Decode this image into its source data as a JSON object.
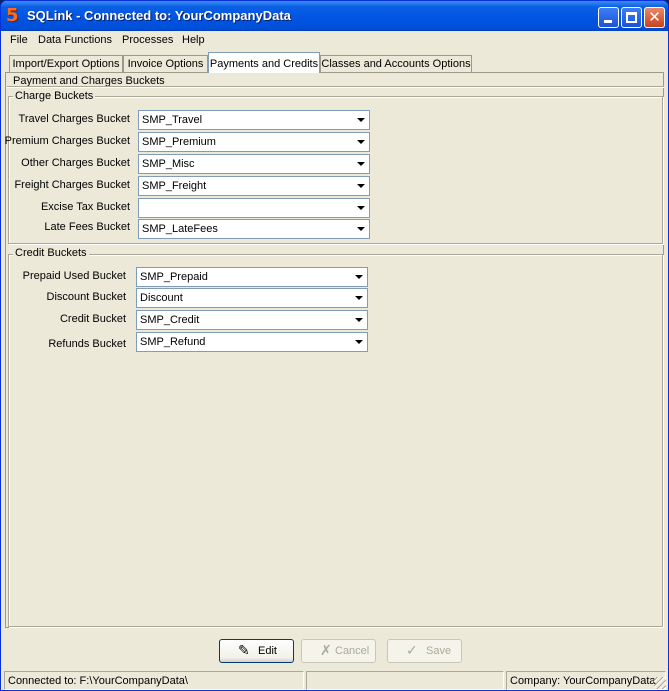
{
  "window": {
    "app_icon_glyph": "5",
    "title": "SQLink - Connected to: YourCompanyData",
    "close_glyph": "✕"
  },
  "menu": {
    "items": [
      {
        "label": "File",
        "name": "file"
      },
      {
        "label": "Data Functions",
        "name": "data-functions"
      },
      {
        "label": "Processes",
        "name": "processes"
      },
      {
        "label": "Help",
        "name": "help"
      }
    ]
  },
  "tabs": [
    {
      "label": "Import/Export Options",
      "active": false
    },
    {
      "label": "Invoice Options",
      "active": false
    },
    {
      "label": "Payments and Credits",
      "active": true
    },
    {
      "label": "Classes and Accounts Options",
      "active": false
    }
  ],
  "panel": {
    "title": "Payment and Charges Buckets",
    "charge_group": {
      "label": "Charge Buckets",
      "fields": [
        {
          "label": "Travel Charges Bucket",
          "value": "SMP_Travel"
        },
        {
          "label": "Premium Charges Bucket",
          "value": "SMP_Premium"
        },
        {
          "label": "Other Charges Bucket",
          "value": "SMP_Misc"
        },
        {
          "label": "Freight Charges Bucket",
          "value": "SMP_Freight"
        },
        {
          "label": "Excise Tax Bucket",
          "value": ""
        },
        {
          "label": "Late Fees Bucket",
          "value": "SMP_LateFees"
        }
      ]
    },
    "credit_group": {
      "label": "Credit Buckets",
      "fields": [
        {
          "label": "Prepaid Used Bucket",
          "value": "SMP_Prepaid"
        },
        {
          "label": "Discount Bucket",
          "value": "Discount"
        },
        {
          "label": "Credit Bucket",
          "value": "SMP_Credit"
        },
        {
          "label": "Refunds Bucket",
          "value": "SMP_Refund"
        }
      ]
    }
  },
  "buttons": {
    "edit": {
      "label": "Edit",
      "icon": "pencil-icon",
      "glyph": "✎",
      "enabled": true
    },
    "cancel": {
      "label": "Cancel",
      "icon": "x-icon",
      "glyph": "✗",
      "enabled": false
    },
    "save": {
      "label": "Save",
      "icon": "checkmark-icon",
      "glyph": "✓",
      "enabled": false
    }
  },
  "status": {
    "connection": "Connected to: F:\\YourCompanyData\\",
    "middle": "",
    "company": "Company: YourCompanyData"
  }
}
